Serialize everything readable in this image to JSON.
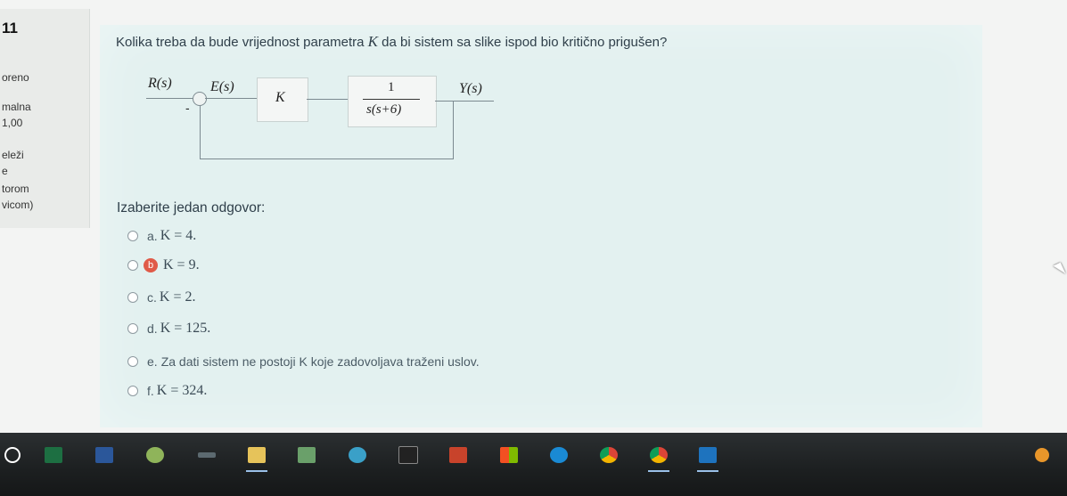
{
  "question": {
    "number": "11",
    "prompt_pre": "Kolika treba da bude vrijednost parametra ",
    "prompt_var": "K",
    "prompt_post": " da bi sistem sa slike ispod bio kritično prigušen?"
  },
  "info_panel": {
    "status": "oreno",
    "marks_label": "malna",
    "marks_value": "1,00",
    "flag_line1": "eleži",
    "flag_line2": "e",
    "flag_line3": "torom",
    "flag_line4": "vicom)"
  },
  "diagram": {
    "input_label": "R(s)",
    "error_label": "E(s)",
    "gain_label": "K",
    "tf_numerator": "1",
    "tf_denominator": "s(s+6)",
    "output_label": "Y(s)",
    "feedback_sign": "-"
  },
  "answers": {
    "prompt": "Izaberite jedan odgovor:",
    "selected_index": 1,
    "options": [
      {
        "letter": "a.",
        "text": "K = 4."
      },
      {
        "letter": "b",
        "text": "K = 9."
      },
      {
        "letter": "c.",
        "text": "K = 2."
      },
      {
        "letter": "d.",
        "text": "K = 125."
      },
      {
        "letter": "e.",
        "text": "Za dati sistem ne postoji K koje zadovoljava traženi uslov."
      },
      {
        "letter": "f.",
        "text": "K = 324."
      }
    ]
  },
  "taskbar": {
    "items": [
      "search-icon",
      "excel-icon",
      "word-icon",
      "matlab-icon",
      "snipping-icon",
      "file-explorer-icon",
      "notepad-icon",
      "app-icon",
      "terminal-icon",
      "powerpoint-icon",
      "store-icon",
      "edge-icon",
      "chrome-icon",
      "chrome-profile-icon",
      "photos-icon",
      "tray-icon"
    ]
  }
}
